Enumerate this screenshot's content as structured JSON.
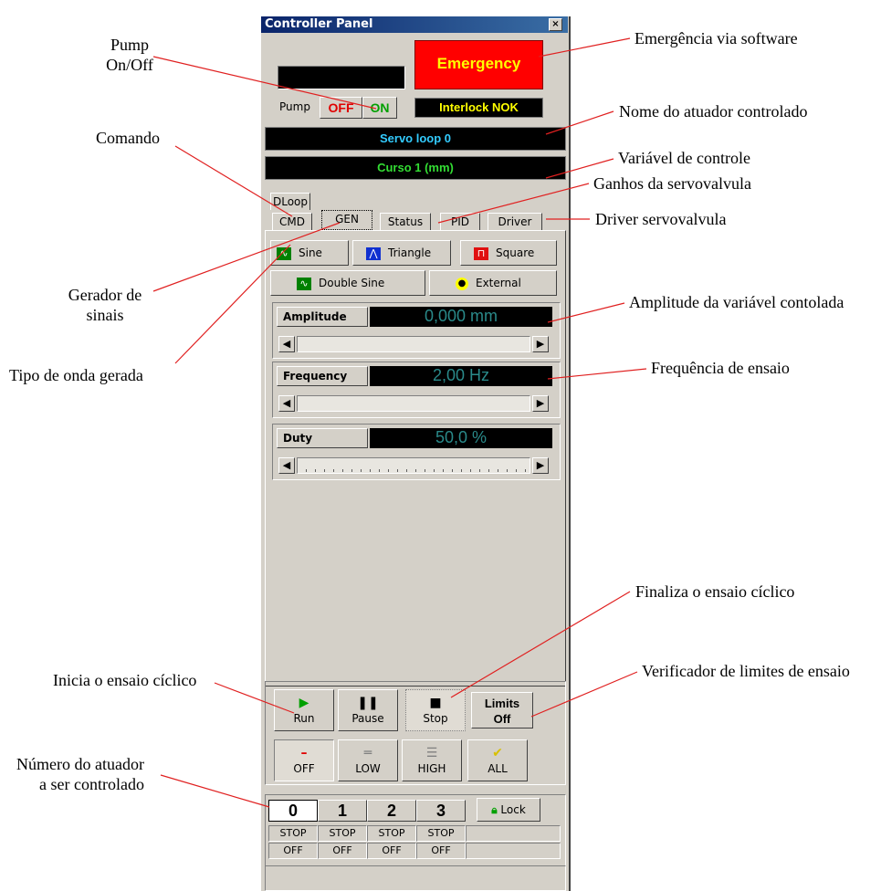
{
  "window": {
    "title": "Controller Panel",
    "close_label": "×"
  },
  "top": {
    "emergency_label": "Emergency",
    "pump_label": "Pump",
    "pump_off": "OFF",
    "pump_on": "ON",
    "interlock": "Interlock NOK",
    "actuator_name": "Servo loop 0",
    "control_variable": "Curso 1 (mm)"
  },
  "tabs": [
    "DLoop",
    "CMD",
    "GEN",
    "Status",
    "PID",
    "Driver"
  ],
  "waves": [
    "Sine",
    "Triangle",
    "Square",
    "Double Sine",
    "External"
  ],
  "params": [
    {
      "label": "Amplitude",
      "value": "0,000 mm"
    },
    {
      "label": "Frequency",
      "value": "2,00 Hz"
    },
    {
      "label": "Duty",
      "value": "50,0 %"
    }
  ],
  "controls": {
    "run": "Run",
    "pause": "Pause",
    "stop": "Stop",
    "limits_line1": "Limits",
    "limits_line2": "Off",
    "off": "OFF",
    "low": "LOW",
    "high": "HIGH",
    "all": "ALL"
  },
  "actuators": {
    "numbers": [
      "0",
      "1",
      "2",
      "3"
    ],
    "lock": "Lock",
    "state_row": [
      "STOP",
      "STOP",
      "STOP",
      "STOP"
    ],
    "pump_row": [
      "OFF",
      "OFF",
      "OFF",
      "OFF"
    ]
  },
  "annotations": {
    "pump_onoff": "Pump\nOn/Off",
    "emergency_sw": "Emergência via software",
    "nome_atuador": "Nome do atuador controlado",
    "comando": "Comando",
    "variavel": "Variável de controle",
    "ganhos": "Ganhos da servovalvula",
    "driver": "Driver servovalvula",
    "gerador": "Gerador de\nsinais",
    "amplitude": "Amplitude da variável contolada",
    "tipo_onda": "Tipo de onda gerada",
    "frequencia": "Frequência de ensaio",
    "finaliza": "Finaliza o ensaio cíclico",
    "inicia": "Inicia o ensaio cíclico",
    "verificador": "Verificador de limites de ensaio",
    "numero": "Número do atuador\na ser controlado"
  },
  "colors": {
    "emergency_bg": "#ff0000",
    "emergency_text": "#ffff00",
    "name_text": "#33ccff",
    "variable_text": "#33dd33",
    "value_text": "#2a8a8a",
    "pump_off": "#e00000",
    "pump_on": "#00a000"
  }
}
